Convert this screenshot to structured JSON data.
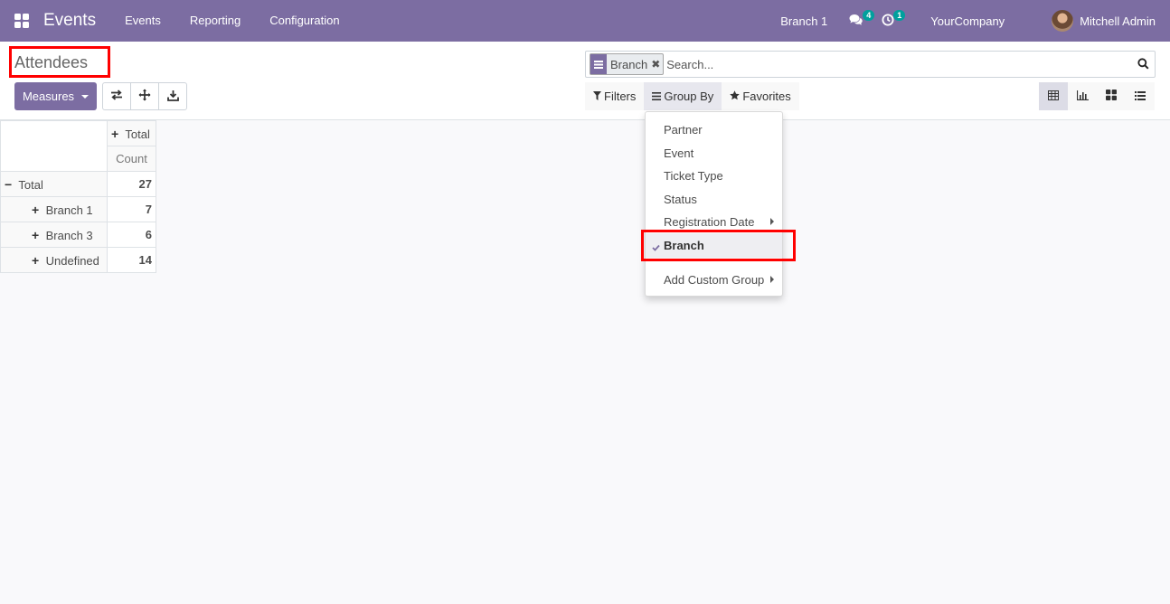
{
  "navbar": {
    "app_name": "Events",
    "menu": [
      "Events",
      "Reporting",
      "Configuration"
    ],
    "branch": "Branch 1",
    "messages_count": "4",
    "activities_count": "1",
    "company": "YourCompany",
    "user": "Mitchell Admin"
  },
  "control_panel": {
    "title": "Attendees",
    "measures_label": "Measures",
    "search": {
      "facet_value": "Branch",
      "placeholder": "Search..."
    },
    "filters_label": "Filters",
    "groupby_label": "Group By",
    "favorites_label": "Favorites",
    "views": [
      "pivot",
      "graph",
      "kanban",
      "list"
    ]
  },
  "groupby_dropdown": {
    "items": [
      {
        "label": "Partner"
      },
      {
        "label": "Event"
      },
      {
        "label": "Ticket Type"
      },
      {
        "label": "Status"
      },
      {
        "label": "Registration Date"
      },
      {
        "label": "Branch"
      }
    ],
    "custom_label": "Add Custom Group"
  },
  "pivot": {
    "col_header": "Total",
    "measure": "Count",
    "total_label": "Total",
    "total_value": "27",
    "rows": [
      {
        "label": "Branch 1",
        "value": "7"
      },
      {
        "label": "Branch 3",
        "value": "6"
      },
      {
        "label": "Undefined",
        "value": "14"
      }
    ]
  },
  "colors": {
    "brand": "#7c6da2",
    "badge": "#00a09d",
    "highlight": "#ff0000"
  }
}
